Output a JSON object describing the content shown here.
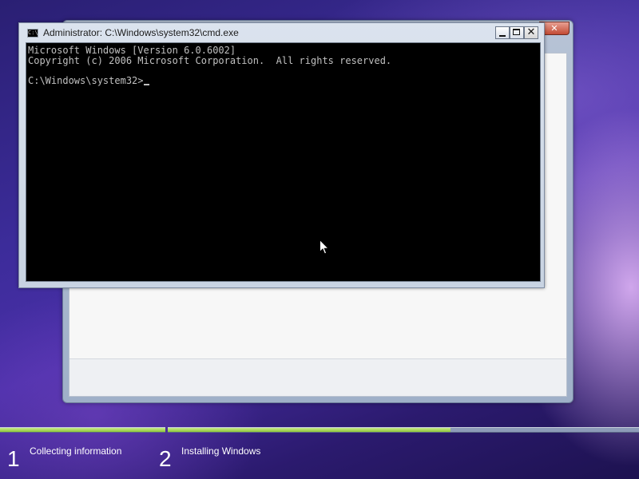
{
  "cmd_window": {
    "title": "Administrator: C:\\Windows\\system32\\cmd.exe",
    "icon": "cmd-icon",
    "lines": [
      "Microsoft Windows [Version 6.0.6002]",
      "Copyright (c) 2006 Microsoft Corporation.  All rights reserved.",
      ""
    ],
    "prompt": "C:\\Windows\\system32>",
    "buttons": [
      "minimize-icon",
      "maximize-icon",
      "close-icon"
    ]
  },
  "setup_window": {
    "close_glyph": "✕"
  },
  "progress": {
    "step1_fraction": 1.0,
    "step2_fraction": 0.6,
    "fill_color": "#8ec63a",
    "track_color": "#8d9bb8"
  },
  "steps": [
    {
      "number": "1",
      "label": "Collecting information"
    },
    {
      "number": "2",
      "label": "Installing Windows"
    }
  ],
  "colors": {
    "console_background": "#000000",
    "console_text": "#c0c0c0"
  }
}
